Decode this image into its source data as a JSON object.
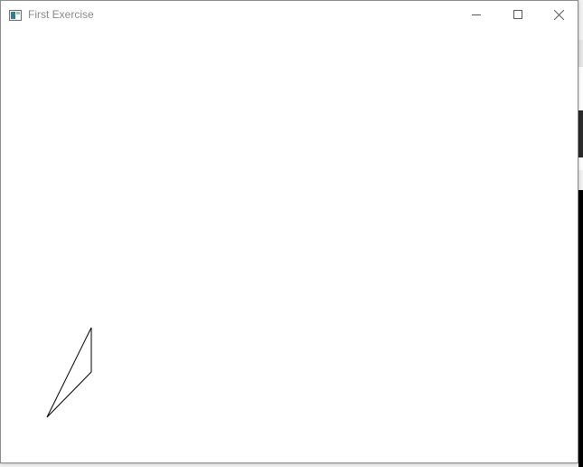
{
  "window": {
    "title": "First Exercise",
    "controls": {
      "minimize": "minimize-icon",
      "maximize": "maximize-icon",
      "close": "close-icon"
    }
  },
  "canvas": {
    "background": "#ffffff",
    "stroke_color": "#000000",
    "shapes": [
      {
        "type": "triangle",
        "label": ""
      }
    ]
  },
  "colors": {
    "title_text": "#8a8a8a",
    "control_glyph": "#5a5a5a"
  }
}
